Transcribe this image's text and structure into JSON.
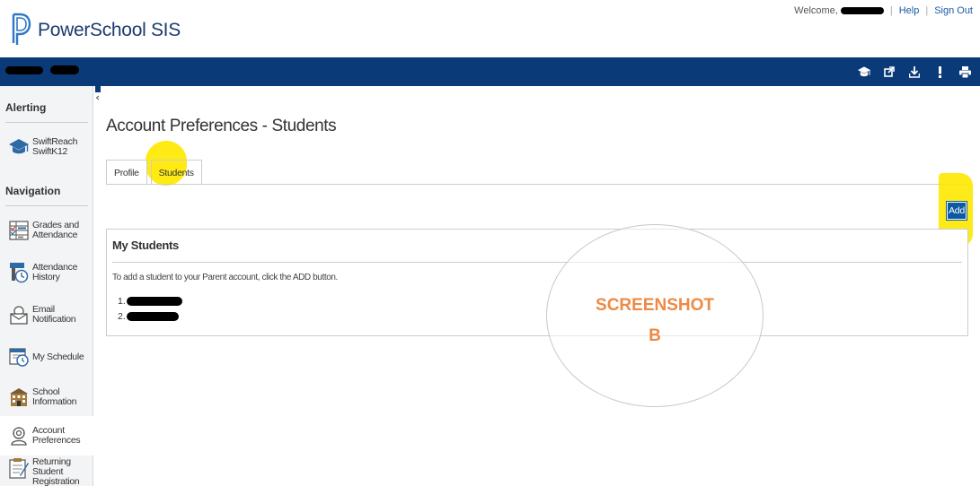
{
  "header": {
    "app_name": "PowerSchool SIS",
    "welcome": "Welcome,",
    "help": "Help",
    "sign_out": "Sign Out"
  },
  "navbar": {
    "icons": [
      "graduation-cap-icon",
      "external-link-icon",
      "download-icon",
      "alert-icon",
      "printer-icon"
    ]
  },
  "sidebar": {
    "alerting_heading": "Alerting",
    "alerting_items": [
      {
        "label_line1": "SwiftReach",
        "label_line2": "SwiftK12",
        "icon": "graduation-cap-icon"
      }
    ],
    "navigation_heading": "Navigation",
    "items": [
      {
        "label_line1": "Grades and",
        "label_line2": "Attendance",
        "icon": "grades-icon"
      },
      {
        "label_line1": "Attendance",
        "label_line2": "History",
        "icon": "attendance-history-icon"
      },
      {
        "label_line1": "Email",
        "label_line2": "Notification",
        "icon": "email-icon"
      },
      {
        "label_line1": "My Schedule",
        "label_line2": "",
        "icon": "schedule-icon"
      },
      {
        "label_line1": "School",
        "label_line2": "Information",
        "icon": "school-icon"
      },
      {
        "label_line1": "Account",
        "label_line2": "Preferences",
        "icon": "account-preferences-icon"
      },
      {
        "label_line1": "Returning",
        "label_line2": "Student",
        "label_line3": "Registration",
        "icon": "registration-icon"
      }
    ]
  },
  "main": {
    "page_title": "Account Preferences - Students",
    "tabs": [
      {
        "label": "Profile"
      },
      {
        "label": "Students"
      }
    ],
    "add_button": "Add",
    "panel": {
      "title": "My Students",
      "note": "To add a student to your Parent account, click the ADD button.",
      "students": [
        {
          "index": "1."
        },
        {
          "index": "2."
        }
      ]
    }
  },
  "annotation": {
    "line1": "SCREENSHOT",
    "line2": "B",
    "text_color": "#ee8a44",
    "highlight_color": "#ffe800"
  },
  "colors": {
    "nav_bar": "#0b3a78",
    "button": "#0b5aa2"
  }
}
